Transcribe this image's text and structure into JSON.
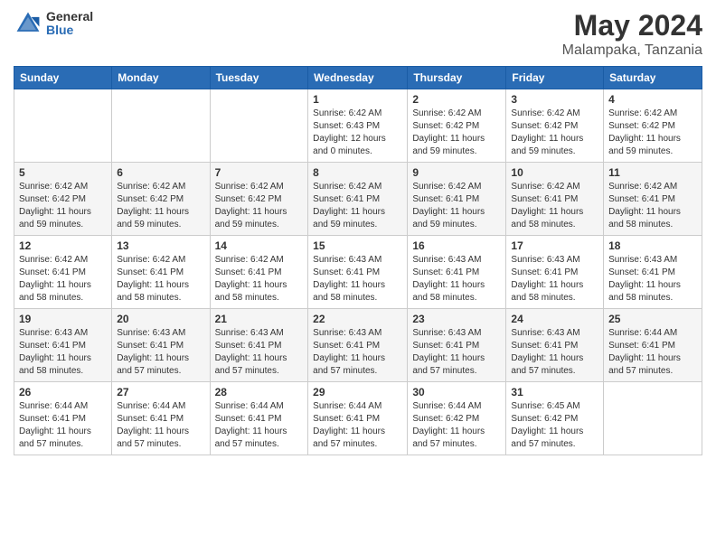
{
  "logo": {
    "general": "General",
    "blue": "Blue"
  },
  "title": "May 2024",
  "location": "Malampaka, Tanzania",
  "days_of_week": [
    "Sunday",
    "Monday",
    "Tuesday",
    "Wednesday",
    "Thursday",
    "Friday",
    "Saturday"
  ],
  "weeks": [
    [
      {
        "day": "",
        "info": ""
      },
      {
        "day": "",
        "info": ""
      },
      {
        "day": "",
        "info": ""
      },
      {
        "day": "1",
        "info": "Sunrise: 6:42 AM\nSunset: 6:43 PM\nDaylight: 12 hours\nand 0 minutes."
      },
      {
        "day": "2",
        "info": "Sunrise: 6:42 AM\nSunset: 6:42 PM\nDaylight: 11 hours\nand 59 minutes."
      },
      {
        "day": "3",
        "info": "Sunrise: 6:42 AM\nSunset: 6:42 PM\nDaylight: 11 hours\nand 59 minutes."
      },
      {
        "day": "4",
        "info": "Sunrise: 6:42 AM\nSunset: 6:42 PM\nDaylight: 11 hours\nand 59 minutes."
      }
    ],
    [
      {
        "day": "5",
        "info": "Sunrise: 6:42 AM\nSunset: 6:42 PM\nDaylight: 11 hours\nand 59 minutes."
      },
      {
        "day": "6",
        "info": "Sunrise: 6:42 AM\nSunset: 6:42 PM\nDaylight: 11 hours\nand 59 minutes."
      },
      {
        "day": "7",
        "info": "Sunrise: 6:42 AM\nSunset: 6:42 PM\nDaylight: 11 hours\nand 59 minutes."
      },
      {
        "day": "8",
        "info": "Sunrise: 6:42 AM\nSunset: 6:41 PM\nDaylight: 11 hours\nand 59 minutes."
      },
      {
        "day": "9",
        "info": "Sunrise: 6:42 AM\nSunset: 6:41 PM\nDaylight: 11 hours\nand 59 minutes."
      },
      {
        "day": "10",
        "info": "Sunrise: 6:42 AM\nSunset: 6:41 PM\nDaylight: 11 hours\nand 58 minutes."
      },
      {
        "day": "11",
        "info": "Sunrise: 6:42 AM\nSunset: 6:41 PM\nDaylight: 11 hours\nand 58 minutes."
      }
    ],
    [
      {
        "day": "12",
        "info": "Sunrise: 6:42 AM\nSunset: 6:41 PM\nDaylight: 11 hours\nand 58 minutes."
      },
      {
        "day": "13",
        "info": "Sunrise: 6:42 AM\nSunset: 6:41 PM\nDaylight: 11 hours\nand 58 minutes."
      },
      {
        "day": "14",
        "info": "Sunrise: 6:42 AM\nSunset: 6:41 PM\nDaylight: 11 hours\nand 58 minutes."
      },
      {
        "day": "15",
        "info": "Sunrise: 6:43 AM\nSunset: 6:41 PM\nDaylight: 11 hours\nand 58 minutes."
      },
      {
        "day": "16",
        "info": "Sunrise: 6:43 AM\nSunset: 6:41 PM\nDaylight: 11 hours\nand 58 minutes."
      },
      {
        "day": "17",
        "info": "Sunrise: 6:43 AM\nSunset: 6:41 PM\nDaylight: 11 hours\nand 58 minutes."
      },
      {
        "day": "18",
        "info": "Sunrise: 6:43 AM\nSunset: 6:41 PM\nDaylight: 11 hours\nand 58 minutes."
      }
    ],
    [
      {
        "day": "19",
        "info": "Sunrise: 6:43 AM\nSunset: 6:41 PM\nDaylight: 11 hours\nand 58 minutes."
      },
      {
        "day": "20",
        "info": "Sunrise: 6:43 AM\nSunset: 6:41 PM\nDaylight: 11 hours\nand 57 minutes."
      },
      {
        "day": "21",
        "info": "Sunrise: 6:43 AM\nSunset: 6:41 PM\nDaylight: 11 hours\nand 57 minutes."
      },
      {
        "day": "22",
        "info": "Sunrise: 6:43 AM\nSunset: 6:41 PM\nDaylight: 11 hours\nand 57 minutes."
      },
      {
        "day": "23",
        "info": "Sunrise: 6:43 AM\nSunset: 6:41 PM\nDaylight: 11 hours\nand 57 minutes."
      },
      {
        "day": "24",
        "info": "Sunrise: 6:43 AM\nSunset: 6:41 PM\nDaylight: 11 hours\nand 57 minutes."
      },
      {
        "day": "25",
        "info": "Sunrise: 6:44 AM\nSunset: 6:41 PM\nDaylight: 11 hours\nand 57 minutes."
      }
    ],
    [
      {
        "day": "26",
        "info": "Sunrise: 6:44 AM\nSunset: 6:41 PM\nDaylight: 11 hours\nand 57 minutes."
      },
      {
        "day": "27",
        "info": "Sunrise: 6:44 AM\nSunset: 6:41 PM\nDaylight: 11 hours\nand 57 minutes."
      },
      {
        "day": "28",
        "info": "Sunrise: 6:44 AM\nSunset: 6:41 PM\nDaylight: 11 hours\nand 57 minutes."
      },
      {
        "day": "29",
        "info": "Sunrise: 6:44 AM\nSunset: 6:41 PM\nDaylight: 11 hours\nand 57 minutes."
      },
      {
        "day": "30",
        "info": "Sunrise: 6:44 AM\nSunset: 6:42 PM\nDaylight: 11 hours\nand 57 minutes."
      },
      {
        "day": "31",
        "info": "Sunrise: 6:45 AM\nSunset: 6:42 PM\nDaylight: 11 hours\nand 57 minutes."
      },
      {
        "day": "",
        "info": ""
      }
    ]
  ]
}
